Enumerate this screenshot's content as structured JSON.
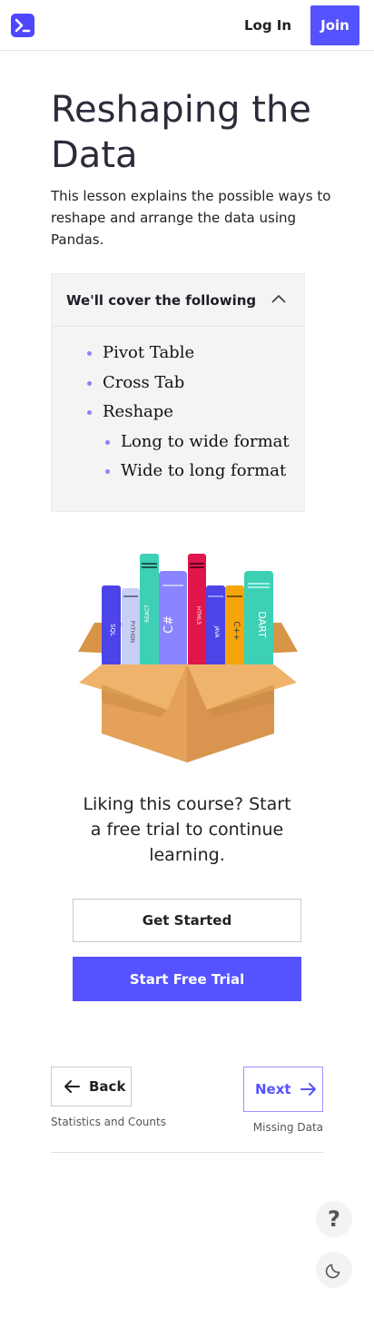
{
  "header": {
    "logo_icon": "terminal-prompt-icon",
    "login_label": "Log In",
    "join_label": "Join",
    "accent": "#5553ff"
  },
  "lesson": {
    "title": "Reshaping the Data",
    "description": "This lesson explains the possible ways to reshape and arrange the data using Pandas."
  },
  "cover": {
    "heading": "We'll cover the following",
    "items": [
      {
        "label": "Pivot Table"
      },
      {
        "label": "Cross Tab"
      },
      {
        "label": "Reshape"
      }
    ],
    "subitems": [
      {
        "label": "Long to wide format"
      },
      {
        "label": "Wide to long format"
      }
    ]
  },
  "illustration": {
    "books": [
      "SQL",
      "PYTHON",
      "REACT",
      "C#",
      "HTML5",
      "JAVA",
      "C++",
      "DART"
    ]
  },
  "promo": {
    "text": "Liking this course? Start a free trial to continue learning.",
    "get_started_label": "Get Started",
    "trial_label": "Start Free Trial"
  },
  "pager": {
    "back_label": "Back",
    "back_sub": "Statistics and Counts",
    "next_label": "Next",
    "next_sub": "Missing Data"
  },
  "fab": {
    "help_label": "?",
    "theme_icon": "moon-icon"
  }
}
